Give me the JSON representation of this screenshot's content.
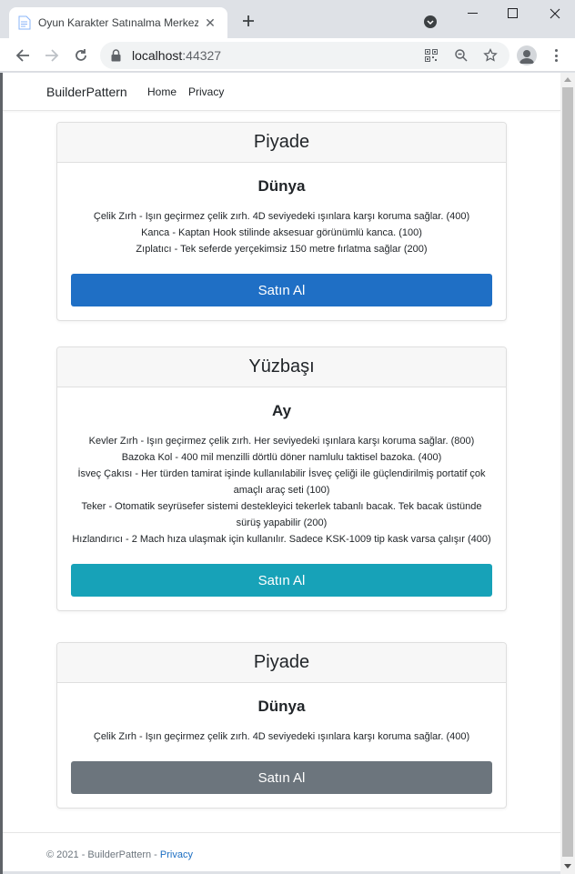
{
  "browser": {
    "tab_title": "Oyun Karakter Satınalma Merkezi",
    "url_host": "localhost",
    "url_port": ":44327"
  },
  "site": {
    "brand": "BuilderPattern",
    "nav": [
      "Home",
      "Privacy"
    ]
  },
  "cards": [
    {
      "header": "Piyade",
      "title": "Dünya",
      "parts": [
        "Çelik Zırh - Işın geçirmez çelik zırh. 4D seviyedeki ışınlara karşı koruma sağlar. (400)",
        "Kanca - Kaptan Hook stilinde aksesuar görünümlü kanca. (100)",
        "Zıplatıcı - Tek seferde yerçekimsiz 150 metre fırlatma sağlar (200)"
      ],
      "button": "Satın Al",
      "button_color": "#1f6fc5"
    },
    {
      "header": "Yüzbaşı",
      "title": "Ay",
      "parts": [
        "Kevler Zırh - Işın geçirmez çelik zırh. Her seviyedeki ışınlara karşı koruma sağlar. (800)",
        "Bazoka Kol - 400 mil menzilli dörtlü döner namlulu taktisel bazoka. (400)",
        "İsveç Çakısı - Her türden tamirat işinde kullanılabilir İsveç çeliği ile güçlendirilmiş portatif çok amaçlı araç seti (100)",
        "Teker - Otomatik seyrüsefer sistemi destekleyici tekerlek tabanlı bacak. Tek bacak üstünde sürüş yapabilir (200)",
        "Hızlandırıcı - 2 Mach hıza ulaşmak için kullanılır. Sadece KSK-1009 tip kask varsa çalışır (400)"
      ],
      "button": "Satın Al",
      "button_color": "#17a2b8"
    },
    {
      "header": "Piyade",
      "title": "Dünya",
      "parts": [
        "Çelik Zırh - Işın geçirmez çelik zırh. 4D seviyedeki ışınlara karşı koruma sağlar. (400)"
      ],
      "button": "Satın Al",
      "button_color": "#6c757d"
    }
  ],
  "footer": {
    "copyright": "© 2021 - BuilderPattern - ",
    "privacy_link": "Privacy"
  }
}
